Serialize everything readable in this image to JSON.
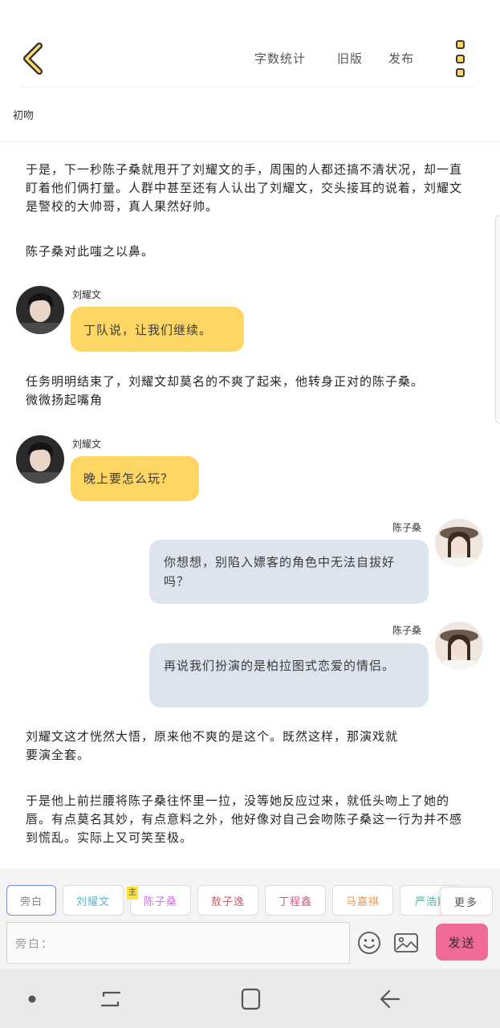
{
  "header": {
    "word_count_label": "字数统计",
    "old_version_label": "旧版",
    "publish_label": "发布"
  },
  "chapter_title": "初吻",
  "narration": [
    "于是，下一秒陈子桑就甩开了刘耀文的手，周围的人都还搞不清状况，却一直盯着他们俩打量。人群中甚至还有人认出了刘耀文，交头接耳的说着，刘耀文是警校的大帅哥，真人果然好帅。",
    "陈子桑对此嗤之以鼻。",
    "任务明明结束了，刘耀文却莫名的不爽了起来，他转身正对的陈子桑。微微扬起嘴角",
    "刘耀文这才恍然大悟，原来他不爽的是这个。既然这样，那演戏就要演全套。",
    "于是他上前拦腰将陈子桑往怀里一拉，没等她反应过来，就低头吻上了她的唇。有点莫名其妙，有点意料之外，他好像对自己会吻陈子桑这一行为并不感到慌乱。实际上又可笑至极。"
  ],
  "messages": [
    {
      "speaker": "刘耀文",
      "text": "丁队说，让我们继续。",
      "side": "left"
    },
    {
      "speaker": "刘耀文",
      "text": "晚上要怎么玩？",
      "side": "left"
    },
    {
      "speaker": "陈子桑",
      "text": "你想想，别陷入嫖客的角色中无法自拔好吗？",
      "side": "right"
    },
    {
      "speaker": "陈子桑",
      "text": "再说我们扮演的是柏拉图式恋爱的情侣。",
      "side": "right"
    }
  ],
  "roles": [
    {
      "label": "旁白",
      "color": "#9a9a9a"
    },
    {
      "label": "刘耀文",
      "color": "#5fb3c8"
    },
    {
      "label": "陈子桑",
      "color": "#c27ad9"
    },
    {
      "label": "敖子逸",
      "color": "#e05a5a"
    },
    {
      "label": "丁程鑫",
      "color": "#e0508a"
    },
    {
      "label": "马嘉祺",
      "color": "#e99a5a"
    },
    {
      "label": "严浩翔",
      "color": "#3fb8a8"
    }
  ],
  "main_tag": "主",
  "more_roles_label": "更多",
  "input": {
    "placeholder": "旁白："
  },
  "send_label": "发送",
  "colors": {
    "accent_yellow": "#fdd663",
    "bubble_right": "#dee4ed",
    "send": "#f06a99"
  }
}
